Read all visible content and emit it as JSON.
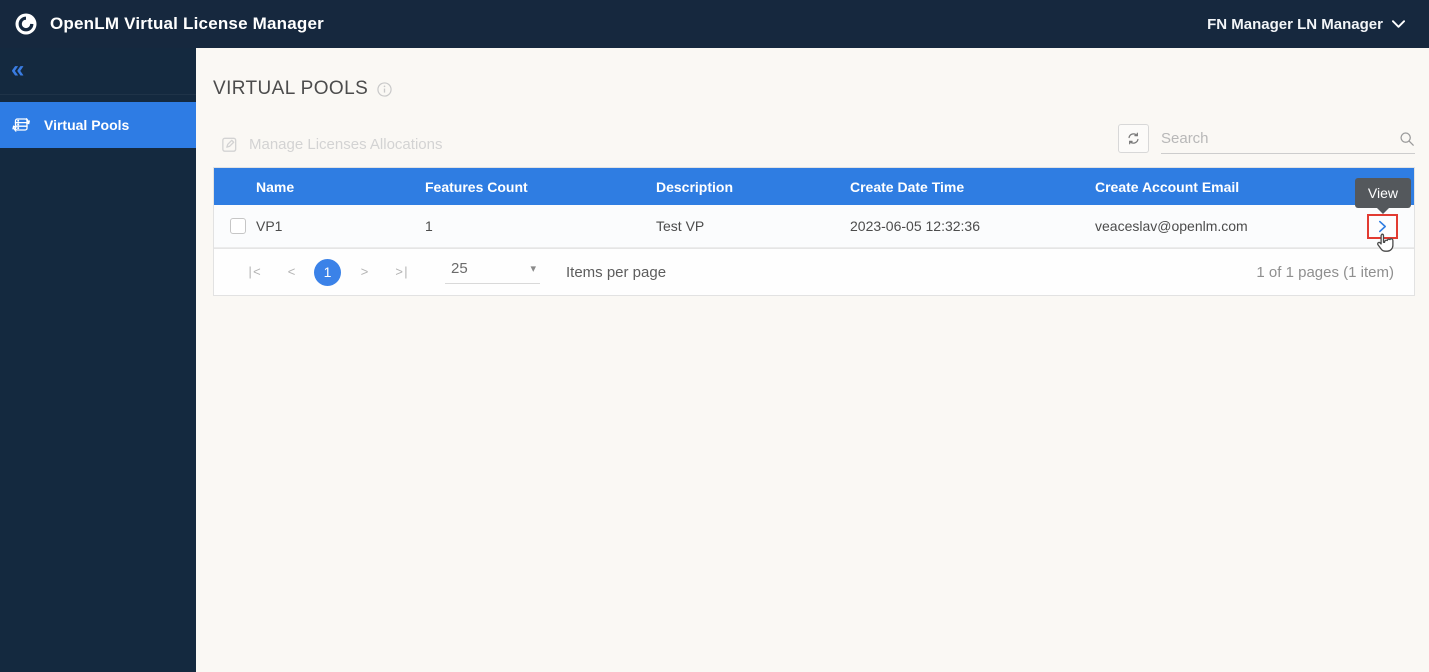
{
  "topbar": {
    "title": "OpenLM Virtual License Manager",
    "user_menu": "FN Manager LN Manager"
  },
  "sidebar": {
    "collapse_glyph": "«",
    "items": [
      {
        "label": "Virtual Pools",
        "active": true
      }
    ]
  },
  "page": {
    "title": "VIRTUAL POOLS"
  },
  "toolbar": {
    "manage_label": "Manage Licenses Allocations",
    "search_placeholder": "Search"
  },
  "table": {
    "columns": [
      "Name",
      "Features Count",
      "Description",
      "Create Date Time",
      "Create Account Email"
    ],
    "rows": [
      {
        "name": "VP1",
        "features_count": "1",
        "description": "Test VP",
        "create_date_time": "2023-06-05 12:32:36",
        "create_account_email": "veaceslav@openlm.com"
      }
    ],
    "view_tooltip": "View"
  },
  "pagination": {
    "first_glyph": "|<",
    "prev_glyph": "<",
    "current_page": "1",
    "next_glyph": ">",
    "last_glyph": ">|",
    "items_per_page_value": "25",
    "caret_glyph": "▾",
    "items_per_page_label": "Items per page",
    "summary": "1 of 1 pages (1 item)"
  },
  "colors": {
    "navbar_navy": "#16283e",
    "sidebar_navy": "#14293f",
    "accent_blue": "#2f7de2",
    "highlight_red": "#e23b32",
    "tooltip_gray": "#54585c",
    "page_background": "#faf8f4"
  }
}
